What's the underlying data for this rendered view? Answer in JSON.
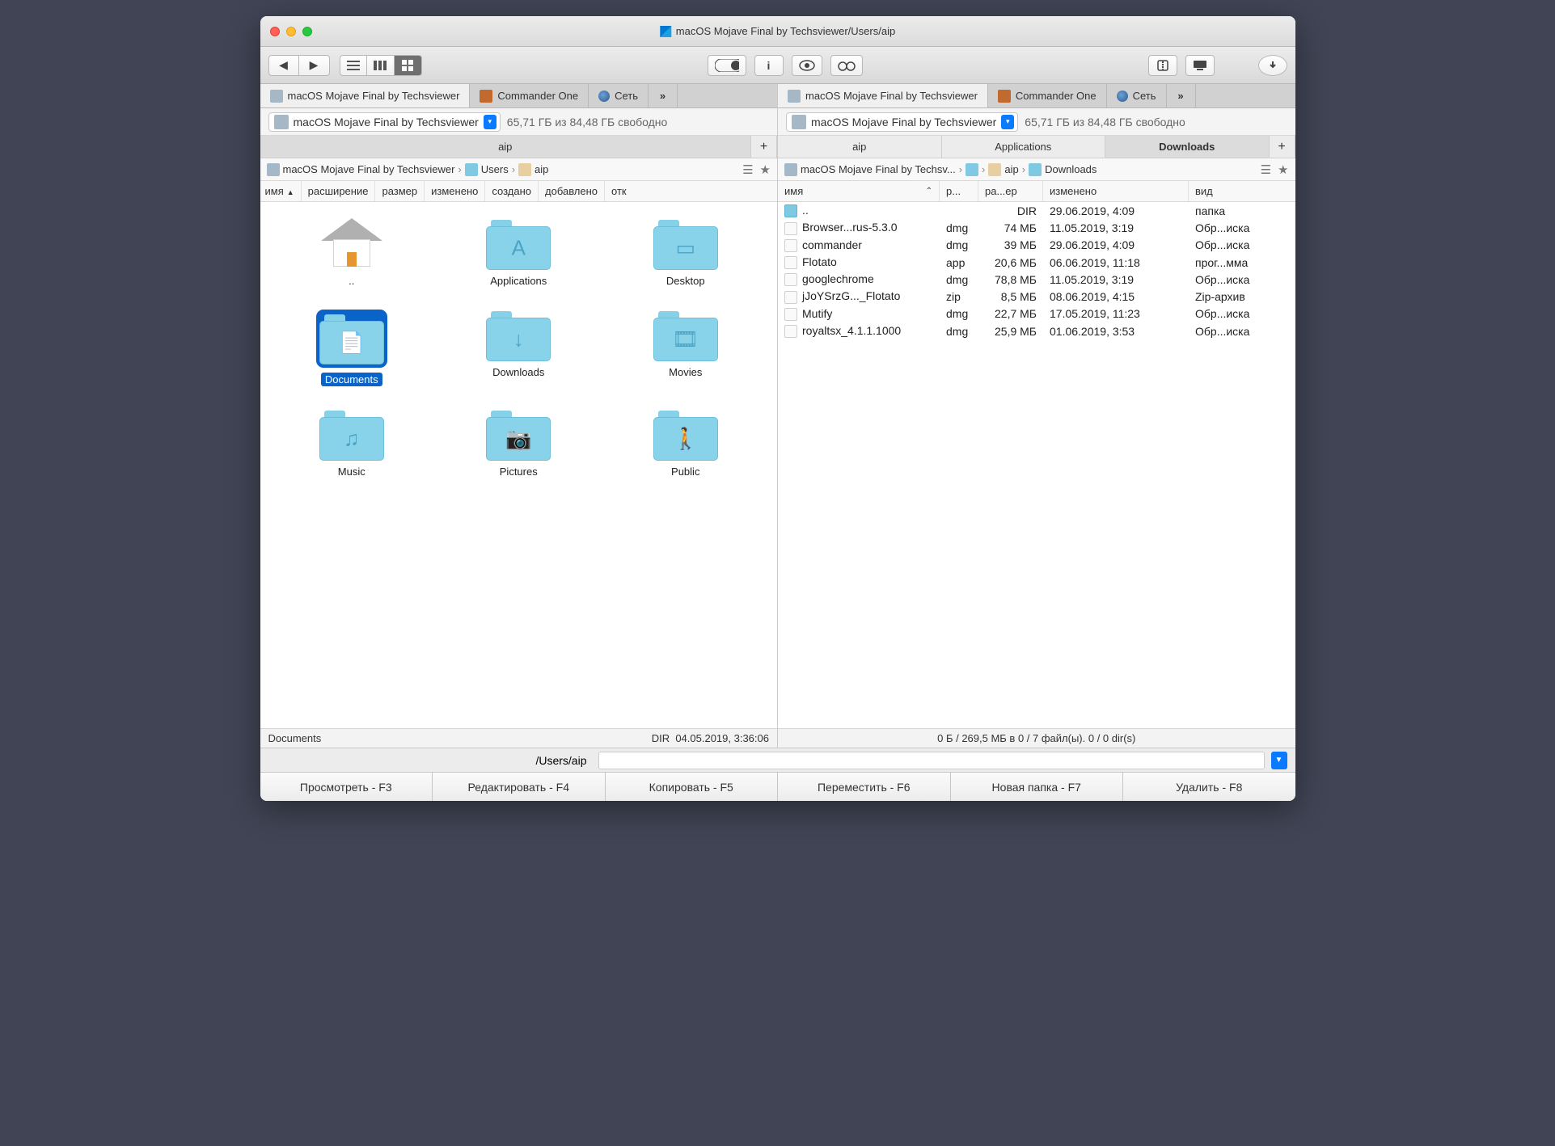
{
  "title": "macOS Mojave Final by Techsviewer/Users/aip",
  "disk_name": "macOS Mojave Final by Techsviewer",
  "disk_free": "65,71 ГБ из 84,48 ГБ свободно",
  "ptabs_l": [
    "macOS Mojave Final by Techsviewer",
    "Commander One",
    "Сеть"
  ],
  "ptabs_r": [
    "macOS Mojave Final by Techsviewer",
    "Commander One",
    "Сеть"
  ],
  "left_tab": "aip",
  "right_tabs": [
    "aip",
    "Applications",
    "Downloads"
  ],
  "crumbs_l": [
    "macOS Mojave Final by Techsviewer",
    "Users",
    "aip"
  ],
  "crumbs_r": [
    "macOS Mojave Final by Techsv...",
    "",
    "aip",
    "Downloads"
  ],
  "cols_l": [
    "имя",
    "расширение",
    "размер",
    "изменено",
    "создано",
    "добавлено",
    "открыто"
  ],
  "cols_r": [
    "имя",
    "р...",
    "ра...ер",
    "изменено",
    "вид"
  ],
  "icons": [
    {
      "label": "..",
      "kind": "home"
    },
    {
      "label": "Applications",
      "kind": "folder",
      "glyph": "A"
    },
    {
      "label": "Desktop",
      "kind": "folder",
      "glyph": "▭"
    },
    {
      "label": "Documents",
      "kind": "folder",
      "glyph": "📄",
      "selected": true
    },
    {
      "label": "Downloads",
      "kind": "folder",
      "glyph": "↓"
    },
    {
      "label": "Movies",
      "kind": "folder",
      "glyph": "🎞"
    },
    {
      "label": "Music",
      "kind": "folder",
      "glyph": "♫"
    },
    {
      "label": "Pictures",
      "kind": "folder",
      "glyph": "📷"
    },
    {
      "label": "Public",
      "kind": "folder",
      "glyph": "🚶"
    }
  ],
  "rows": [
    {
      "n": "..",
      "e": "",
      "s": "DIR",
      "m": "29.06.2019, 4:09",
      "t": "папка",
      "ic": "fldr"
    },
    {
      "n": "Browser...rus-5.3.0",
      "e": "dmg",
      "s": "74 МБ",
      "m": "11.05.2019, 3:19",
      "t": "Обр...иска"
    },
    {
      "n": "commander",
      "e": "dmg",
      "s": "39 МБ",
      "m": "29.06.2019, 4:09",
      "t": "Обр...иска"
    },
    {
      "n": "Flotato",
      "e": "app",
      "s": "20,6 МБ",
      "m": "06.06.2019, 11:18",
      "t": "прог...мма",
      "ic": "app"
    },
    {
      "n": "googlechrome",
      "e": "dmg",
      "s": "78,8 МБ",
      "m": "11.05.2019, 3:19",
      "t": "Обр...иска"
    },
    {
      "n": "jJoYSrzG..._Flotato",
      "e": "zip",
      "s": "8,5 МБ",
      "m": "08.06.2019, 4:15",
      "t": "Zip-архив"
    },
    {
      "n": "Mutify",
      "e": "dmg",
      "s": "22,7 МБ",
      "m": "17.05.2019, 11:23",
      "t": "Обр...иска"
    },
    {
      "n": "royaltsx_4.1.1.1000",
      "e": "dmg",
      "s": "25,9 МБ",
      "m": "01.06.2019, 3:53",
      "t": "Обр...иска"
    }
  ],
  "status_l": {
    "name": "Documents",
    "dir": "DIR",
    "date": "04.05.2019, 3:36:06"
  },
  "status_r": "0 Б / 269,5 МБ в 0 / 7 файл(ы). 0 / 0 dir(s)",
  "path": "/Users/aip",
  "fns": [
    "Просмотреть - F3",
    "Редактировать - F4",
    "Копировать - F5",
    "Переместить - F6",
    "Новая папка - F7",
    "Удалить - F8"
  ]
}
